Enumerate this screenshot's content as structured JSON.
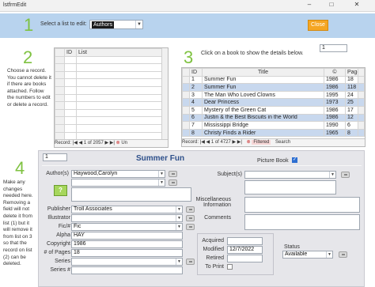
{
  "window": {
    "title": "lstfrmEdit",
    "minimize": "–",
    "maximize": "□",
    "close": "✕"
  },
  "steps": {
    "one": "1",
    "two": "2",
    "three": "3",
    "four": "4"
  },
  "header": {
    "select_label": "Select a list to edit:",
    "list_value": "Authors",
    "close_label": "Close"
  },
  "instructions": {
    "step2": "Choose a record. You cannot delete it if there are books attached. Follow the numbers to edit or delete a record.",
    "step3": "Click on a book to show the details below.",
    "step4": "Make any changes needed here. Removing a field will not delete it from list (1) but it will remove it from list on 3 so that the record on list (2) can be deleted."
  },
  "list_grid": {
    "columns": [
      "ID",
      "List"
    ],
    "nav": {
      "prefix": "Record:",
      "position": "1 of 2057",
      "filter": "Un"
    }
  },
  "books_grid": {
    "counter": "1",
    "columns": [
      "ID",
      "Title",
      "©",
      "Pages"
    ],
    "rows": [
      {
        "id": "1",
        "title": "Summer Fun",
        "year": "1986",
        "pages": "18"
      },
      {
        "id": "2",
        "title": "Summer Fun",
        "year": "1986",
        "pages": "118"
      },
      {
        "id": "3",
        "title": "The Man Who Loved Clowns",
        "year": "1995",
        "pages": "24"
      },
      {
        "id": "4",
        "title": "Dear Princess",
        "year": "1973",
        "pages": "25"
      },
      {
        "id": "5",
        "title": "Mystery of the Green Cat",
        "year": "1986",
        "pages": "17"
      },
      {
        "id": "6",
        "title": "Justin & the Best Biscuits in the World",
        "year": "1986",
        "pages": "12"
      },
      {
        "id": "7",
        "title": "Mississippi Bridge",
        "year": "1990",
        "pages": "6"
      },
      {
        "id": "8",
        "title": "Christy Finds a Rider",
        "year": "1965",
        "pages": "8"
      }
    ],
    "nav": {
      "prefix": "Record:",
      "position": "1 of 4727",
      "filter": "Filtered",
      "search": "Search"
    }
  },
  "detail": {
    "record_id": "1",
    "book_title": "Summer Fun",
    "picture_book_label": "Picture Book",
    "labels": {
      "authors": "Author(s)",
      "subjects": "Subject(s)",
      "publisher": "Publisher",
      "illustrator": "Illustrator",
      "fic": "Fic/#",
      "alpha": "Alpha",
      "copyright": "Copyright",
      "pages": "# of Pages",
      "series": "Series",
      "series_num": "Series #",
      "misc": "Miscellaneous Information",
      "comments": "Comments",
      "acquired": "Acquired",
      "modified": "Modified",
      "retired": "Retired",
      "to_print": "To Print",
      "status": "Status"
    },
    "values": {
      "author1": "Haywood,Carolyn",
      "publisher": "Troll Associates",
      "fic": "Fic",
      "alpha": "HAY",
      "copyright": "1986",
      "pages": "18",
      "modified": "12/7/2022",
      "status": "Available"
    }
  }
}
